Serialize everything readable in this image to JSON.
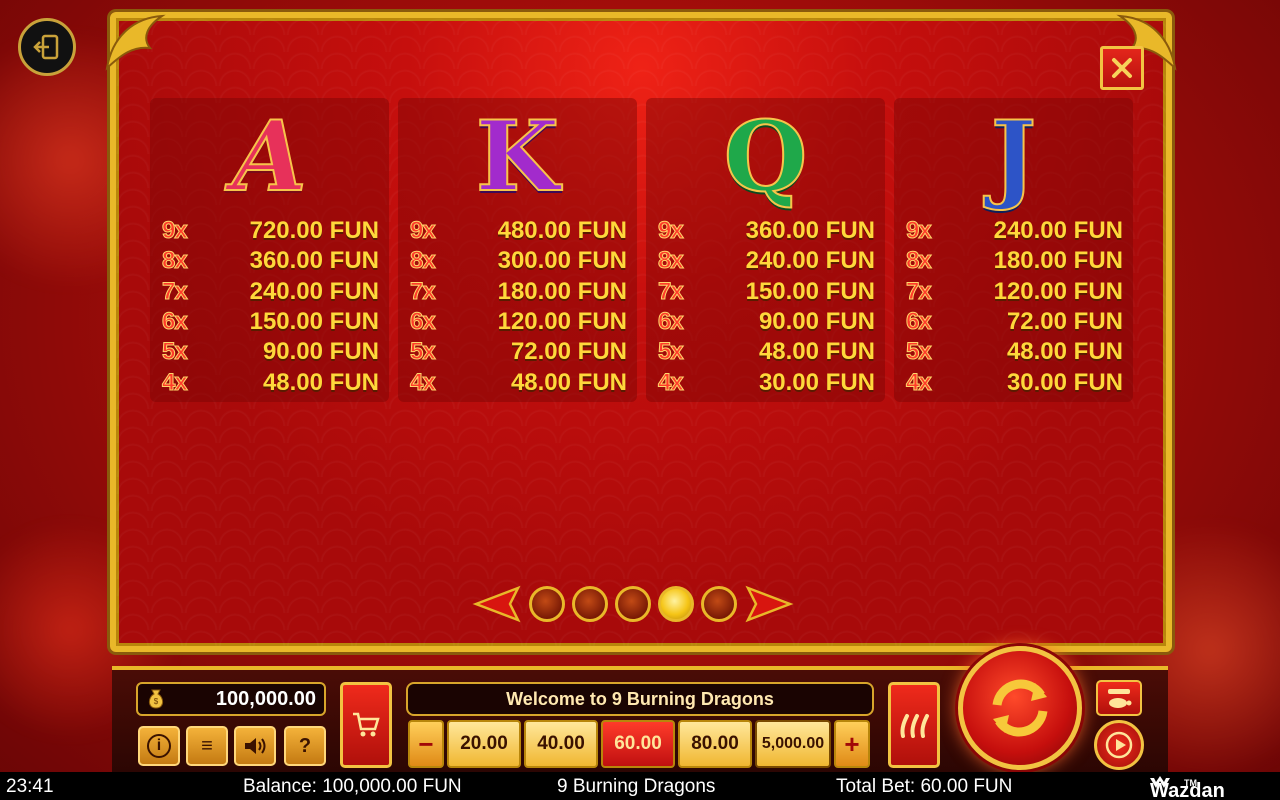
{
  "game": {
    "welcome_message": "Welcome to 9 Burning Dragons"
  },
  "paytable": {
    "cards": [
      {
        "symbol": "A",
        "rows": [
          {
            "count": "9x",
            "value": "720.00 FUN"
          },
          {
            "count": "8x",
            "value": "360.00 FUN"
          },
          {
            "count": "7x",
            "value": "240.00 FUN"
          },
          {
            "count": "6x",
            "value": "150.00 FUN"
          },
          {
            "count": "5x",
            "value": "90.00 FUN"
          },
          {
            "count": "4x",
            "value": "48.00 FUN"
          }
        ]
      },
      {
        "symbol": "K",
        "rows": [
          {
            "count": "9x",
            "value": "480.00 FUN"
          },
          {
            "count": "8x",
            "value": "300.00 FUN"
          },
          {
            "count": "7x",
            "value": "180.00 FUN"
          },
          {
            "count": "6x",
            "value": "120.00 FUN"
          },
          {
            "count": "5x",
            "value": "72.00 FUN"
          },
          {
            "count": "4x",
            "value": "48.00 FUN"
          }
        ]
      },
      {
        "symbol": "Q",
        "rows": [
          {
            "count": "9x",
            "value": "360.00 FUN"
          },
          {
            "count": "8x",
            "value": "240.00 FUN"
          },
          {
            "count": "7x",
            "value": "150.00 FUN"
          },
          {
            "count": "6x",
            "value": "90.00 FUN"
          },
          {
            "count": "5x",
            "value": "48.00 FUN"
          },
          {
            "count": "4x",
            "value": "30.00 FUN"
          }
        ]
      },
      {
        "symbol": "J",
        "rows": [
          {
            "count": "9x",
            "value": "240.00 FUN"
          },
          {
            "count": "8x",
            "value": "180.00 FUN"
          },
          {
            "count": "7x",
            "value": "120.00 FUN"
          },
          {
            "count": "6x",
            "value": "72.00 FUN"
          },
          {
            "count": "5x",
            "value": "48.00 FUN"
          },
          {
            "count": "4x",
            "value": "30.00 FUN"
          }
        ]
      }
    ],
    "pagination": {
      "total_pages": 5,
      "current_page": 4
    }
  },
  "panel": {
    "balance_display": "100,000.00",
    "small_buttons": [
      {
        "label": "i",
        "icon": "info-icon"
      },
      {
        "label": "≡",
        "icon": "menu-icon"
      },
      {
        "label": "🔊",
        "icon": "sound-icon"
      },
      {
        "label": "?",
        "icon": "help-icon"
      }
    ],
    "bet_minus": "−",
    "bet_plus": "+",
    "bet_options": [
      "20.00",
      "40.00",
      "60.00",
      "80.00"
    ],
    "selected_bet": "60.00",
    "max_bet": "5,000.00"
  },
  "status_bar": {
    "time": "23:41",
    "balance": "Balance: 100,000.00 FUN",
    "game_title": "9 Burning Dragons",
    "total_bet": "Total Bet: 60.00 FUN",
    "brand": "Wazdan",
    "brand_tm": "TM"
  },
  "colors": {
    "frame_gold": "#e9b829",
    "background_red": "#c60f0d",
    "pay_value_yellow": "#ffd83b",
    "pay_count_red": "#ff3b2a"
  }
}
